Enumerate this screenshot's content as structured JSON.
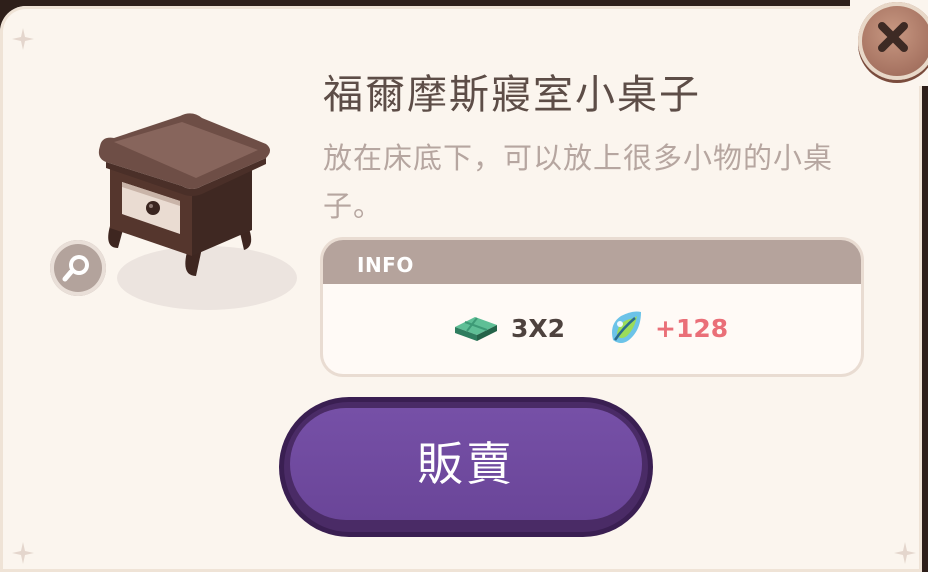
{
  "item": {
    "name": "福爾摩斯寢室小桌子",
    "description": "放在床底下，可以放上很多小物的小桌子。"
  },
  "info": {
    "header": "INFO",
    "size_icon": "green-tile-icon",
    "size": "3X2",
    "bonus_icon": "leaf-droplet-icon",
    "bonus": "+128"
  },
  "actions": {
    "sell_label": "販賣",
    "close_icon": "close-icon",
    "zoom_icon": "magnifier-icon"
  },
  "colors": {
    "panel": "#fbf5ee",
    "title": "#5d4d47",
    "description": "#b6a6a0",
    "info_header": "#b5a39c",
    "bonus": "#ea6f78",
    "sell_button": "#6a4598"
  }
}
